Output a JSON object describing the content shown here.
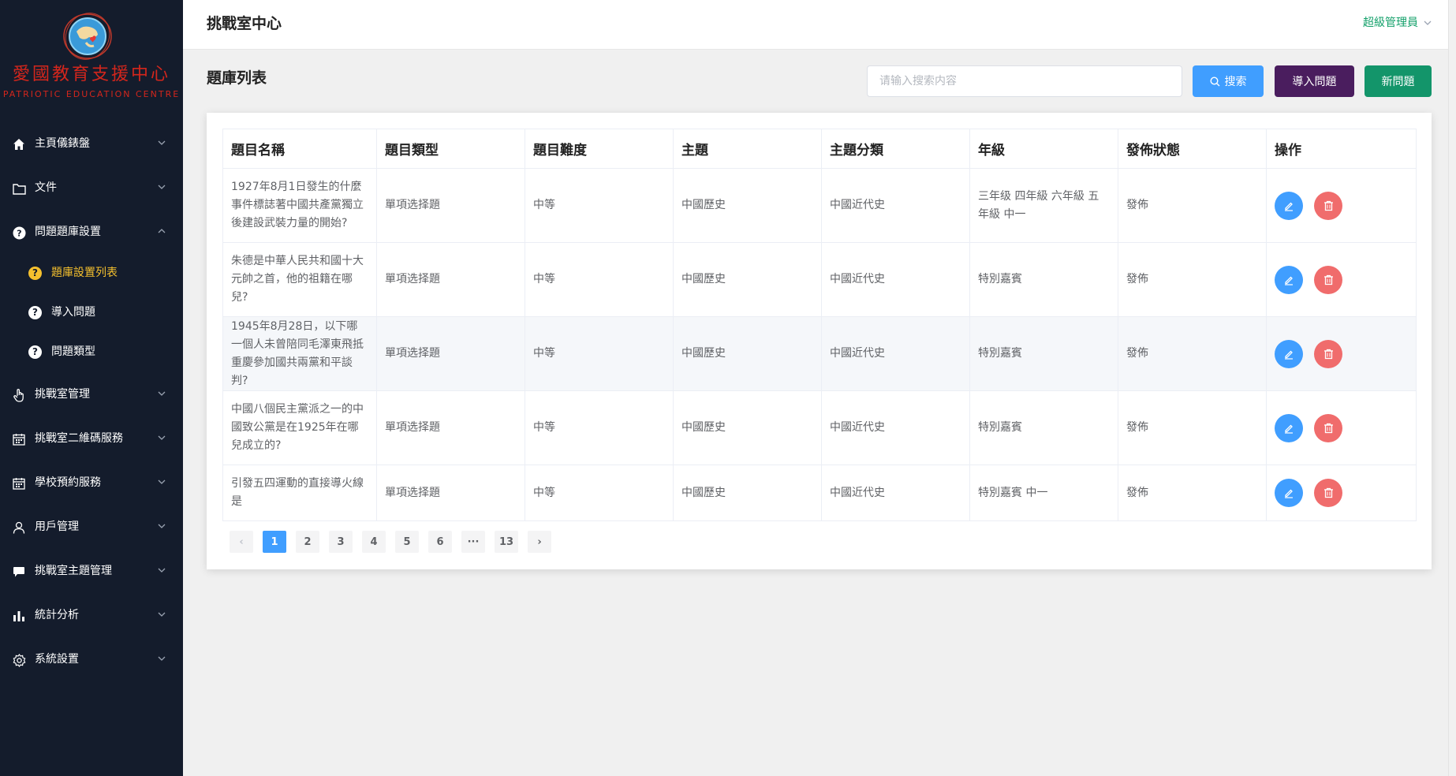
{
  "sidebar": {
    "logo": {
      "cn": "愛國教育支援中心",
      "en": "PATRIOTIC EDUCATION CENTRE"
    },
    "items": [
      {
        "label": "主頁儀錶盤",
        "icon": "home-icon"
      },
      {
        "label": "文件",
        "icon": "folder-icon"
      },
      {
        "label": "問題題庫設置",
        "icon": "question-circle-icon",
        "expanded": true
      },
      {
        "label": "挑戰室管理",
        "icon": "hand-pointer-icon"
      },
      {
        "label": "挑戰室二維碼服務",
        "icon": "calendar-icon"
      },
      {
        "label": "學校預約服務",
        "icon": "calendar-icon"
      },
      {
        "label": "用戶管理",
        "icon": "user-icon"
      },
      {
        "label": "挑戰室主題管理",
        "icon": "chat-bubble-icon"
      },
      {
        "label": "統計分析",
        "icon": "bar-chart-icon"
      },
      {
        "label": "系統設置",
        "icon": "gear-icon"
      }
    ],
    "sub_items": [
      {
        "label": "題庫設置列表",
        "active": true
      },
      {
        "label": "導入問題",
        "active": false
      },
      {
        "label": "問題類型",
        "active": false
      }
    ]
  },
  "header": {
    "title": "挑戰室中心",
    "user_menu": "超級管理員"
  },
  "main": {
    "page_title": "題庫列表",
    "search_placeholder": "请输入搜索内容",
    "search_value": "",
    "search_button": "搜索",
    "import_button": "導入問題",
    "new_button": "新問題",
    "table": {
      "columns": [
        "題目名稱",
        "題目類型",
        "題目難度",
        "主題",
        "主題分類",
        "年級",
        "發佈狀態",
        "操作"
      ],
      "rows": [
        {
          "name": "1927年8月1日發生的什麼事件標誌著中國共產黨獨立後建設武裝力量的開始?",
          "type": "單項选择題",
          "difficulty": "中等",
          "topic": "中國歷史",
          "category": "中國近代史",
          "grade": "三年级 四年級 六年級 五年級 中一",
          "status": "發佈"
        },
        {
          "name": "朱德是中華人民共和國十大元帥之首，他的祖籍在哪兒?",
          "type": "單項选择題",
          "difficulty": "中等",
          "topic": "中國歷史",
          "category": "中國近代史",
          "grade": "特別嘉賓",
          "status": "發佈"
        },
        {
          "name": "1945年8月28日，以下哪一個人未曾陪同毛澤東飛抵重慶參加國共兩黨和平談判?",
          "type": "單項选择題",
          "difficulty": "中等",
          "topic": "中國歷史",
          "category": "中國近代史",
          "grade": "特別嘉賓",
          "status": "發佈"
        },
        {
          "name": "中國八個民主黨派之一的中國致公黨是在1925年在哪兒成立的?",
          "type": "單項选择題",
          "difficulty": "中等",
          "topic": "中國歷史",
          "category": "中國近代史",
          "grade": "特別嘉賓",
          "status": "發佈"
        },
        {
          "name": "引發五四運動的直接導火線是",
          "type": "單項选择題",
          "difficulty": "中等",
          "topic": "中國歷史",
          "category": "中國近代史",
          "grade": "特別嘉賓 中一",
          "status": "發佈"
        }
      ]
    },
    "pagination": {
      "prev": "‹",
      "pages": [
        "1",
        "2",
        "3",
        "4",
        "5",
        "6",
        "···",
        "13"
      ],
      "current": "1",
      "next": "›"
    }
  },
  "colors": {
    "sidebar_bg": "#141c2c",
    "active_menu": "#f5c02e",
    "primary": "#409eff",
    "import_btn": "#4a1d5e",
    "new_btn": "#13956a",
    "delete": "#f06c6c",
    "logo_red": "#d3261c",
    "user_menu": "#13a06a"
  }
}
